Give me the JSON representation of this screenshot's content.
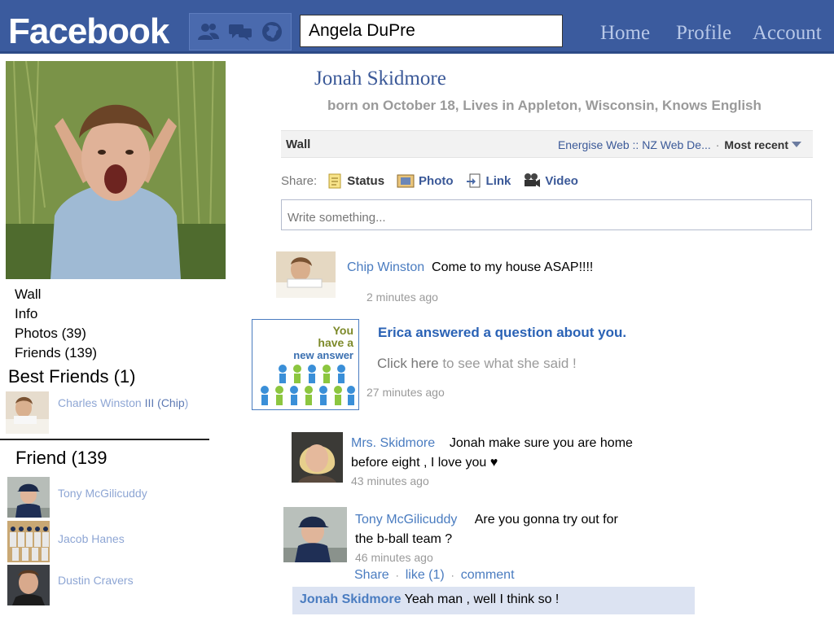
{
  "header": {
    "logo": "Facebook",
    "search_value": "Angela DuPre",
    "nav": [
      "Home",
      "Profile",
      "Account"
    ],
    "jewel_icons": [
      "friend-requests-icon",
      "messages-icon",
      "notifications-globe-icon"
    ]
  },
  "sidebar": {
    "profile_photo_icon": "person-photo",
    "links": [
      "Wall",
      "Info",
      "Photos  (39)",
      "Friends  (139)"
    ],
    "best_friends_title": "Best Friends (1)",
    "best_friend": {
      "name_part1": "Charles Winston ",
      "name_part2": "III (Chip",
      "name_part3": ")"
    },
    "friends_title": "Friend (139",
    "friends": [
      "Tony McGilicuddy",
      "Jacob Hanes",
      "Dustin Cravers"
    ]
  },
  "profile": {
    "name": "Jonah Skidmore",
    "info": "born on October 18, Lives in Appleton, Wisconsin, Knows English"
  },
  "wall": {
    "label": "Wall",
    "source": "Energise Web :: NZ Web De...",
    "sort": "Most recent",
    "share_label": "Share:",
    "share_options": [
      "Status",
      "Photo",
      "Link",
      "Video"
    ],
    "placeholder": "Write something..."
  },
  "posts": {
    "p1": {
      "author": "Chip Winston",
      "text": "Come to my house ASAP!!!!",
      "time": "2 minutes ago"
    },
    "p2": {
      "image_line1": "You",
      "image_line2": "have a",
      "image_line3": "new answer",
      "title": "Erica answered a question about you.",
      "link": "Click here",
      "link_suffix": " to see what she said !",
      "time": "27 minutes ago"
    },
    "p3": {
      "author": "Mrs. Skidmore",
      "text1": "Jonah make sure you are home",
      "text2": "before eight , I love you ♥",
      "time": "43 minutes ago"
    },
    "p4": {
      "author": "Tony McGilicuddy",
      "text1": "Are you gonna try out for",
      "text2": "the b-ball team ?",
      "time": "46 minutes ago",
      "actions": [
        "Share",
        "like (1)",
        "comment"
      ],
      "comment_author": "Jonah Skidmore",
      "comment_text": " Yeah man , well I think so !"
    }
  }
}
